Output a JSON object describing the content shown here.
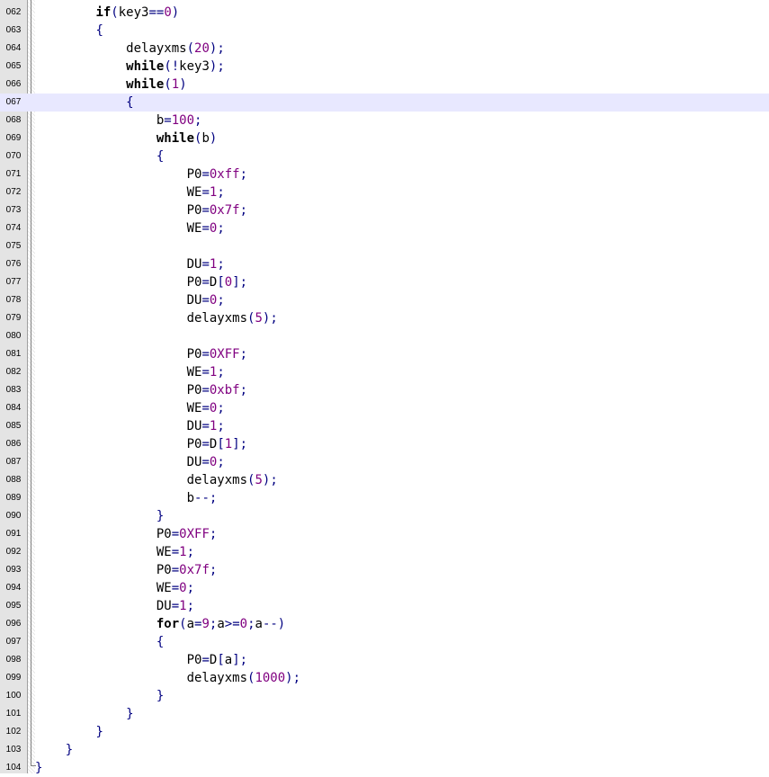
{
  "editor": {
    "lines": [
      {
        "number": "062",
        "tokens": [
          {
            "t": "ws",
            "v": "        "
          },
          {
            "t": "kw",
            "v": "if"
          },
          {
            "t": "op",
            "v": "("
          },
          {
            "t": "id",
            "v": "key3"
          },
          {
            "t": "op",
            "v": "=="
          },
          {
            "t": "num",
            "v": "0"
          },
          {
            "t": "op",
            "v": ")"
          }
        ]
      },
      {
        "number": "063",
        "tokens": [
          {
            "t": "ws",
            "v": "        "
          },
          {
            "t": "op",
            "v": "{"
          }
        ]
      },
      {
        "number": "064",
        "tokens": [
          {
            "t": "ws",
            "v": "            "
          },
          {
            "t": "id",
            "v": "delayxms"
          },
          {
            "t": "op",
            "v": "("
          },
          {
            "t": "num",
            "v": "20"
          },
          {
            "t": "op",
            "v": ");"
          }
        ]
      },
      {
        "number": "065",
        "tokens": [
          {
            "t": "ws",
            "v": "            "
          },
          {
            "t": "kw",
            "v": "while"
          },
          {
            "t": "op",
            "v": "(!"
          },
          {
            "t": "id",
            "v": "key3"
          },
          {
            "t": "op",
            "v": ");"
          }
        ]
      },
      {
        "number": "066",
        "tokens": [
          {
            "t": "ws",
            "v": "            "
          },
          {
            "t": "kw",
            "v": "while"
          },
          {
            "t": "op",
            "v": "("
          },
          {
            "t": "num",
            "v": "1"
          },
          {
            "t": "op",
            "v": ")"
          }
        ]
      },
      {
        "number": "067",
        "current": true,
        "tokens": [
          {
            "t": "ws",
            "v": "            "
          },
          {
            "t": "op",
            "v": "{"
          }
        ]
      },
      {
        "number": "068",
        "tokens": [
          {
            "t": "ws",
            "v": "                "
          },
          {
            "t": "id",
            "v": "b"
          },
          {
            "t": "op",
            "v": "="
          },
          {
            "t": "num",
            "v": "100"
          },
          {
            "t": "op",
            "v": ";"
          }
        ]
      },
      {
        "number": "069",
        "tokens": [
          {
            "t": "ws",
            "v": "                "
          },
          {
            "t": "kw",
            "v": "while"
          },
          {
            "t": "op",
            "v": "("
          },
          {
            "t": "id",
            "v": "b"
          },
          {
            "t": "op",
            "v": ")"
          }
        ]
      },
      {
        "number": "070",
        "tokens": [
          {
            "t": "ws",
            "v": "                "
          },
          {
            "t": "op",
            "v": "{"
          }
        ]
      },
      {
        "number": "071",
        "tokens": [
          {
            "t": "ws",
            "v": "                    "
          },
          {
            "t": "id",
            "v": "P0"
          },
          {
            "t": "op",
            "v": "="
          },
          {
            "t": "num",
            "v": "0xff"
          },
          {
            "t": "op",
            "v": ";"
          }
        ]
      },
      {
        "number": "072",
        "tokens": [
          {
            "t": "ws",
            "v": "                    "
          },
          {
            "t": "id",
            "v": "WE"
          },
          {
            "t": "op",
            "v": "="
          },
          {
            "t": "num",
            "v": "1"
          },
          {
            "t": "op",
            "v": ";"
          }
        ]
      },
      {
        "number": "073",
        "tokens": [
          {
            "t": "ws",
            "v": "                    "
          },
          {
            "t": "id",
            "v": "P0"
          },
          {
            "t": "op",
            "v": "="
          },
          {
            "t": "num",
            "v": "0x7f"
          },
          {
            "t": "op",
            "v": ";"
          }
        ]
      },
      {
        "number": "074",
        "tokens": [
          {
            "t": "ws",
            "v": "                    "
          },
          {
            "t": "id",
            "v": "WE"
          },
          {
            "t": "op",
            "v": "="
          },
          {
            "t": "num",
            "v": "0"
          },
          {
            "t": "op",
            "v": ";"
          }
        ]
      },
      {
        "number": "075",
        "tokens": []
      },
      {
        "number": "076",
        "tokens": [
          {
            "t": "ws",
            "v": "                    "
          },
          {
            "t": "id",
            "v": "DU"
          },
          {
            "t": "op",
            "v": "="
          },
          {
            "t": "num",
            "v": "1"
          },
          {
            "t": "op",
            "v": ";"
          }
        ]
      },
      {
        "number": "077",
        "tokens": [
          {
            "t": "ws",
            "v": "                    "
          },
          {
            "t": "id",
            "v": "P0"
          },
          {
            "t": "op",
            "v": "="
          },
          {
            "t": "id",
            "v": "D"
          },
          {
            "t": "op",
            "v": "["
          },
          {
            "t": "num",
            "v": "0"
          },
          {
            "t": "op",
            "v": "];"
          }
        ]
      },
      {
        "number": "078",
        "tokens": [
          {
            "t": "ws",
            "v": "                    "
          },
          {
            "t": "id",
            "v": "DU"
          },
          {
            "t": "op",
            "v": "="
          },
          {
            "t": "num",
            "v": "0"
          },
          {
            "t": "op",
            "v": ";"
          }
        ]
      },
      {
        "number": "079",
        "tokens": [
          {
            "t": "ws",
            "v": "                    "
          },
          {
            "t": "id",
            "v": "delayxms"
          },
          {
            "t": "op",
            "v": "("
          },
          {
            "t": "num",
            "v": "5"
          },
          {
            "t": "op",
            "v": ");"
          }
        ]
      },
      {
        "number": "080",
        "tokens": []
      },
      {
        "number": "081",
        "tokens": [
          {
            "t": "ws",
            "v": "                    "
          },
          {
            "t": "id",
            "v": "P0"
          },
          {
            "t": "op",
            "v": "="
          },
          {
            "t": "num",
            "v": "0XFF"
          },
          {
            "t": "op",
            "v": ";"
          }
        ]
      },
      {
        "number": "082",
        "tokens": [
          {
            "t": "ws",
            "v": "                    "
          },
          {
            "t": "id",
            "v": "WE"
          },
          {
            "t": "op",
            "v": "="
          },
          {
            "t": "num",
            "v": "1"
          },
          {
            "t": "op",
            "v": ";"
          }
        ]
      },
      {
        "number": "083",
        "tokens": [
          {
            "t": "ws",
            "v": "                    "
          },
          {
            "t": "id",
            "v": "P0"
          },
          {
            "t": "op",
            "v": "="
          },
          {
            "t": "num",
            "v": "0xbf"
          },
          {
            "t": "op",
            "v": ";"
          }
        ]
      },
      {
        "number": "084",
        "tokens": [
          {
            "t": "ws",
            "v": "                    "
          },
          {
            "t": "id",
            "v": "WE"
          },
          {
            "t": "op",
            "v": "="
          },
          {
            "t": "num",
            "v": "0"
          },
          {
            "t": "op",
            "v": ";"
          }
        ]
      },
      {
        "number": "085",
        "tokens": [
          {
            "t": "ws",
            "v": "                    "
          },
          {
            "t": "id",
            "v": "DU"
          },
          {
            "t": "op",
            "v": "="
          },
          {
            "t": "num",
            "v": "1"
          },
          {
            "t": "op",
            "v": ";"
          }
        ]
      },
      {
        "number": "086",
        "tokens": [
          {
            "t": "ws",
            "v": "                    "
          },
          {
            "t": "id",
            "v": "P0"
          },
          {
            "t": "op",
            "v": "="
          },
          {
            "t": "id",
            "v": "D"
          },
          {
            "t": "op",
            "v": "["
          },
          {
            "t": "num",
            "v": "1"
          },
          {
            "t": "op",
            "v": "];"
          }
        ]
      },
      {
        "number": "087",
        "tokens": [
          {
            "t": "ws",
            "v": "                    "
          },
          {
            "t": "id",
            "v": "DU"
          },
          {
            "t": "op",
            "v": "="
          },
          {
            "t": "num",
            "v": "0"
          },
          {
            "t": "op",
            "v": ";"
          }
        ]
      },
      {
        "number": "088",
        "tokens": [
          {
            "t": "ws",
            "v": "                    "
          },
          {
            "t": "id",
            "v": "delayxms"
          },
          {
            "t": "op",
            "v": "("
          },
          {
            "t": "num",
            "v": "5"
          },
          {
            "t": "op",
            "v": ");"
          }
        ]
      },
      {
        "number": "089",
        "tokens": [
          {
            "t": "ws",
            "v": "                    "
          },
          {
            "t": "id",
            "v": "b"
          },
          {
            "t": "op",
            "v": "--;"
          }
        ]
      },
      {
        "number": "090",
        "tokens": [
          {
            "t": "ws",
            "v": "                "
          },
          {
            "t": "op",
            "v": "}"
          }
        ]
      },
      {
        "number": "091",
        "tokens": [
          {
            "t": "ws",
            "v": "                "
          },
          {
            "t": "id",
            "v": "P0"
          },
          {
            "t": "op",
            "v": "="
          },
          {
            "t": "num",
            "v": "0XFF"
          },
          {
            "t": "op",
            "v": ";"
          }
        ]
      },
      {
        "number": "092",
        "tokens": [
          {
            "t": "ws",
            "v": "                "
          },
          {
            "t": "id",
            "v": "WE"
          },
          {
            "t": "op",
            "v": "="
          },
          {
            "t": "num",
            "v": "1"
          },
          {
            "t": "op",
            "v": ";"
          }
        ]
      },
      {
        "number": "093",
        "tokens": [
          {
            "t": "ws",
            "v": "                "
          },
          {
            "t": "id",
            "v": "P0"
          },
          {
            "t": "op",
            "v": "="
          },
          {
            "t": "num",
            "v": "0x7f"
          },
          {
            "t": "op",
            "v": ";"
          }
        ]
      },
      {
        "number": "094",
        "tokens": [
          {
            "t": "ws",
            "v": "                "
          },
          {
            "t": "id",
            "v": "WE"
          },
          {
            "t": "op",
            "v": "="
          },
          {
            "t": "num",
            "v": "0"
          },
          {
            "t": "op",
            "v": ";"
          }
        ]
      },
      {
        "number": "095",
        "tokens": [
          {
            "t": "ws",
            "v": "                "
          },
          {
            "t": "id",
            "v": "DU"
          },
          {
            "t": "op",
            "v": "="
          },
          {
            "t": "num",
            "v": "1"
          },
          {
            "t": "op",
            "v": ";"
          }
        ]
      },
      {
        "number": "096",
        "tokens": [
          {
            "t": "ws",
            "v": "                "
          },
          {
            "t": "kw",
            "v": "for"
          },
          {
            "t": "op",
            "v": "("
          },
          {
            "t": "id",
            "v": "a"
          },
          {
            "t": "op",
            "v": "="
          },
          {
            "t": "num",
            "v": "9"
          },
          {
            "t": "op",
            "v": ";"
          },
          {
            "t": "id",
            "v": "a"
          },
          {
            "t": "op",
            "v": ">="
          },
          {
            "t": "num",
            "v": "0"
          },
          {
            "t": "op",
            "v": ";"
          },
          {
            "t": "id",
            "v": "a"
          },
          {
            "t": "op",
            "v": "--)"
          }
        ]
      },
      {
        "number": "097",
        "tokens": [
          {
            "t": "ws",
            "v": "                "
          },
          {
            "t": "op",
            "v": "{"
          }
        ]
      },
      {
        "number": "098",
        "tokens": [
          {
            "t": "ws",
            "v": "                    "
          },
          {
            "t": "id",
            "v": "P0"
          },
          {
            "t": "op",
            "v": "="
          },
          {
            "t": "id",
            "v": "D"
          },
          {
            "t": "op",
            "v": "["
          },
          {
            "t": "id",
            "v": "a"
          },
          {
            "t": "op",
            "v": "];"
          }
        ]
      },
      {
        "number": "099",
        "tokens": [
          {
            "t": "ws",
            "v": "                    "
          },
          {
            "t": "id",
            "v": "delayxms"
          },
          {
            "t": "op",
            "v": "("
          },
          {
            "t": "num",
            "v": "1000"
          },
          {
            "t": "op",
            "v": ");"
          }
        ]
      },
      {
        "number": "100",
        "tokens": [
          {
            "t": "ws",
            "v": "                "
          },
          {
            "t": "op",
            "v": "}"
          }
        ]
      },
      {
        "number": "101",
        "tokens": [
          {
            "t": "ws",
            "v": "            "
          },
          {
            "t": "op",
            "v": "}"
          }
        ]
      },
      {
        "number": "102",
        "tokens": [
          {
            "t": "ws",
            "v": "        "
          },
          {
            "t": "op",
            "v": "}"
          }
        ]
      },
      {
        "number": "103",
        "tokens": [
          {
            "t": "ws",
            "v": "    "
          },
          {
            "t": "op",
            "v": "}"
          }
        ]
      },
      {
        "number": "104",
        "tokens": [
          {
            "t": "op",
            "v": "}"
          }
        ]
      }
    ],
    "colors": {
      "keyword": "#000000",
      "number": "#800080",
      "operator": "#000080",
      "identifier": "#000000",
      "current_line_bg": "#e8e8ff",
      "gutter_bg": "#e4e4e4"
    }
  }
}
